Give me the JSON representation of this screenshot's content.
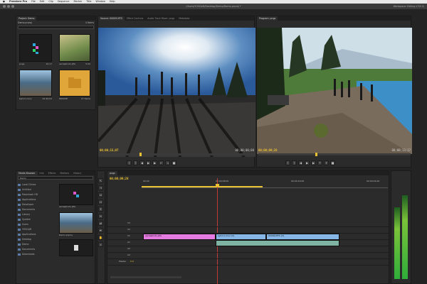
{
  "menubar": {
    "app_name": "Premiere Pro",
    "items": [
      "File",
      "Edit",
      "Clip",
      "Sequence",
      "Marker",
      "Title",
      "Window",
      "Help"
    ]
  },
  "window": {
    "title": "/Users/YOSGAR/Desktop/Demo/Demo.prproj *",
    "workspace_label": "Workspace: Editing (CS5.5)"
  },
  "project_panel": {
    "tab": "Project: Demo",
    "file": "Demo.prproj",
    "item_count": "4 Items",
    "items": [
      {
        "name": "pngs",
        "info": "10:17"
      },
      {
        "name": "aerialphoto.JPG",
        "info": "5:00"
      },
      {
        "name": "kyhm1.mov",
        "info": "22:20:03"
      },
      {
        "name": "PRIVATE",
        "info": "27 items"
      }
    ]
  },
  "source_monitor": {
    "tabs": [
      "Source: 00009.MTS",
      "Effect Controls",
      "Audio Track Mixer: pngs",
      "Metadata"
    ],
    "timecode_in": "00;00;15;07",
    "timecode_out": "00;00;00;00"
  },
  "program_monitor": {
    "tab": "Program: pngs",
    "timecode_in": "00;00;09;28",
    "timecode_out": "00;00;13;17"
  },
  "media_browser": {
    "tabs": [
      "Media Browser",
      "Info",
      "Effects",
      "Markers",
      "History"
    ],
    "path": "Demo",
    "tree": [
      "Local Drives",
      "Untitled",
      "Macintosh HD",
      "Applications",
      "Developer",
      "Documents",
      "Library",
      "System",
      "Users",
      "YOSGAR",
      "Applications",
      "Desktop",
      "Demo",
      "Documents",
      "Downloads"
    ],
    "preview_items": [
      {
        "name": "aerialphoto.JPG",
        "info": "00;00;05;00"
      },
      {
        "name": "Demo.prproj",
        "info": ""
      },
      {
        "name": "kyhm1.mov",
        "info": "00;00;22;20"
      },
      {
        "name": "desktop",
        "info": ""
      }
    ]
  },
  "timeline": {
    "tab": "pngs",
    "timecode": "00;00;09;28",
    "ruler": [
      "00;00",
      "00;00;08;00",
      "00;00;16;00",
      "00;00;24;00"
    ],
    "tracks_video": [
      "V3",
      "V2",
      "V1"
    ],
    "tracks_audio": [
      "A1",
      "A2",
      "A3"
    ],
    "master_label": "Master",
    "master_value": "0.0",
    "clips": [
      {
        "name": "aerialphoto.JPG",
        "color": "#e57be0"
      },
      {
        "name": "kyhm1.mov [V]",
        "color": "#86b6e6"
      },
      {
        "name": "00009.MTS [V]",
        "color": "#86b6e6"
      }
    ]
  },
  "audio_meters": {
    "left_level": 0.72,
    "right_level": 0.84
  }
}
